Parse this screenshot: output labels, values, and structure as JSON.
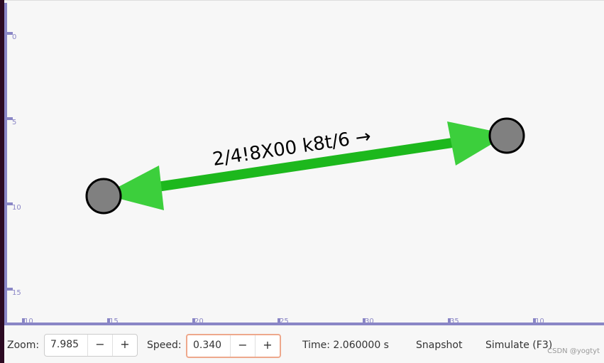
{
  "axes": {
    "y_ticks": [
      "0",
      "5",
      "10",
      "15"
    ],
    "x_ticks": [
      "10",
      "15",
      "20",
      "25",
      "30",
      "35",
      "10"
    ]
  },
  "scene": {
    "edge_label": "2/4!8X00 k8t/6 →",
    "edge_color": "#1db81d",
    "arrow_color": "#3ccf3c",
    "node_color": "#808080"
  },
  "toolbar": {
    "zoom_label": "Zoom:",
    "zoom_value": "7.985",
    "speed_label": "Speed:",
    "speed_value": "0.340",
    "minus": "−",
    "plus": "+",
    "time": "Time: 2.060000 s",
    "snapshot": "Snapshot",
    "simulate": "Simulate (F3)"
  },
  "watermark": "CSDN @yogtyt"
}
